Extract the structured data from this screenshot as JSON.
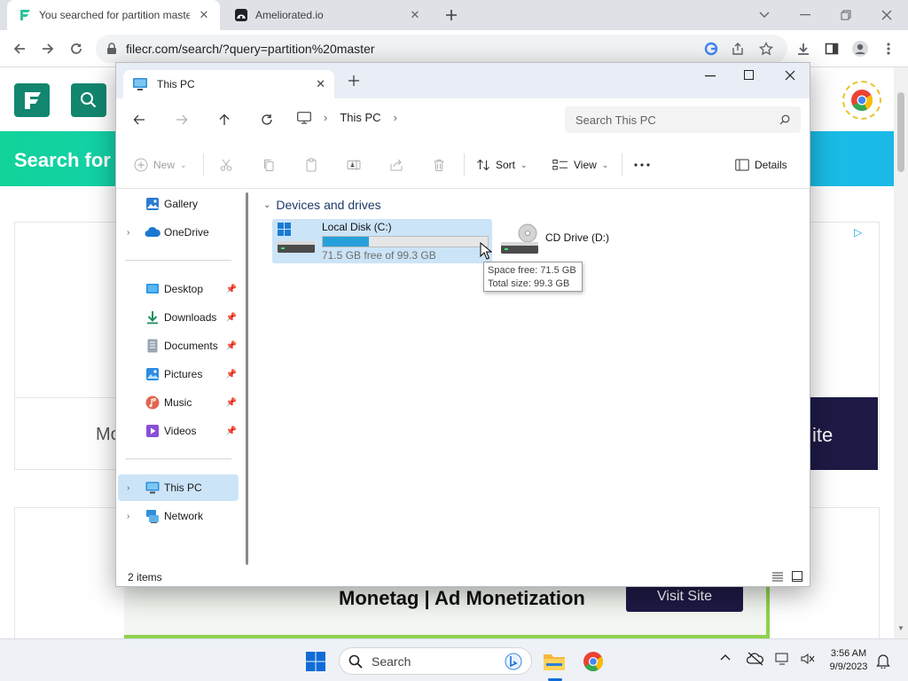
{
  "browser": {
    "tabs": [
      {
        "title": "You searched for partition maste",
        "active": true
      },
      {
        "title": "Ameliorated.io",
        "active": false
      }
    ],
    "url": "filecr.com/search/?query=partition%20master"
  },
  "website": {
    "banner_text": "Search for",
    "ad_left_text": "Mo",
    "ad_right_text": "ite",
    "bottom_ad_text": "Monetag | Ad Monetization",
    "bottom_ad_button": "Visit Site"
  },
  "explorer": {
    "tab_title": "This PC",
    "breadcrumb": "This PC",
    "search_placeholder": "Search This PC",
    "commands": {
      "new": "New",
      "sort": "Sort",
      "view": "View",
      "details": "Details"
    },
    "sidebar": {
      "top": [
        {
          "label": "Gallery",
          "icon": "gallery-icon"
        },
        {
          "label": "OneDrive",
          "icon": "onedrive-icon"
        }
      ],
      "quick": [
        {
          "label": "Desktop",
          "icon": "desktop-icon"
        },
        {
          "label": "Downloads",
          "icon": "downloads-icon"
        },
        {
          "label": "Documents",
          "icon": "documents-icon"
        },
        {
          "label": "Pictures",
          "icon": "pictures-icon"
        },
        {
          "label": "Music",
          "icon": "music-icon"
        },
        {
          "label": "Videos",
          "icon": "videos-icon"
        }
      ],
      "bottom": [
        {
          "label": "This PC",
          "icon": "this-pc-icon",
          "selected": true
        },
        {
          "label": "Network",
          "icon": "network-icon"
        }
      ]
    },
    "section_title": "Devices and drives",
    "drives": [
      {
        "name": "Local Disk (C:)",
        "free_text": "71.5 GB free of 99.3 GB",
        "used_fraction": 0.28
      },
      {
        "name": "CD Drive (D:)"
      }
    ],
    "tooltip": {
      "line1": "Space free: 71.5 GB",
      "line2": "Total size: 99.3 GB"
    },
    "status": "2 items"
  },
  "taskbar": {
    "search_label": "Search",
    "time": "3:56 AM",
    "date": "9/9/2023"
  },
  "colors": {
    "accent": "#26a0da",
    "banner": "#19c7d9",
    "brand": "#12866f",
    "ad_dark": "#1d1a45"
  }
}
